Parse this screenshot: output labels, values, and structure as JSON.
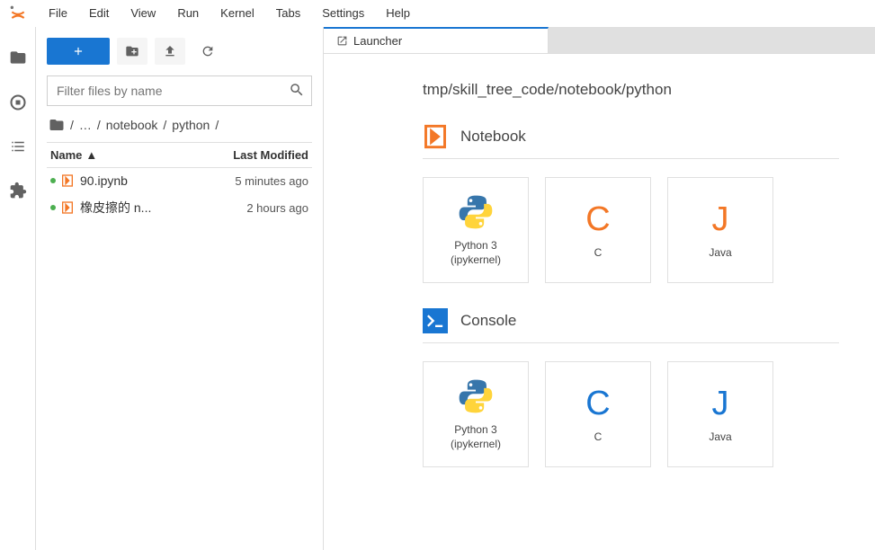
{
  "menu": {
    "file": "File",
    "edit": "Edit",
    "view": "View",
    "run": "Run",
    "kernel": "Kernel",
    "tabs": "Tabs",
    "settings": "Settings",
    "help": "Help"
  },
  "filebrowser": {
    "filter_placeholder": "Filter files by name",
    "breadcrumb": {
      "part1": "notebook",
      "part2": "python"
    },
    "header": {
      "name": "Name",
      "modified": "Last Modified"
    },
    "files": [
      {
        "name": "90.ipynb",
        "modified": "5 minutes ago"
      },
      {
        "name": "橡皮擦的 n...",
        "modified": "2 hours ago"
      }
    ]
  },
  "tab": {
    "label": "Launcher"
  },
  "launcher": {
    "path": "tmp/skill_tree_code/notebook/python",
    "sections": [
      {
        "title": "Notebook",
        "icon": "notebook",
        "cards": [
          {
            "label": "Python 3\n(ipykernel)",
            "icon": "python"
          },
          {
            "label": "C",
            "icon": "C",
            "color": "c-orange"
          },
          {
            "label": "Java",
            "icon": "J",
            "color": "c-orange"
          }
        ]
      },
      {
        "title": "Console",
        "icon": "console",
        "cards": [
          {
            "label": "Python 3\n(ipykernel)",
            "icon": "python"
          },
          {
            "label": "C",
            "icon": "C",
            "color": "c-blue"
          },
          {
            "label": "Java",
            "icon": "J",
            "color": "c-blue"
          }
        ]
      }
    ]
  }
}
